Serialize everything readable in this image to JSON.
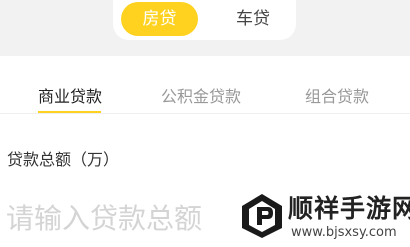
{
  "loan_type": {
    "options": [
      {
        "label": "房贷",
        "selected": true
      },
      {
        "label": "车贷",
        "selected": false
      }
    ]
  },
  "tabs": [
    {
      "label": "商业贷款",
      "active": true
    },
    {
      "label": "公积金贷款",
      "active": false
    },
    {
      "label": "组合贷款",
      "active": false
    }
  ],
  "form": {
    "amount_label": "贷款总额（万）",
    "amount_value": "",
    "amount_placeholder": "请输入贷款总额"
  },
  "watermark": {
    "title": "顺祥手游网",
    "url": "www.bjsxsy.com"
  },
  "colors": {
    "accent": "#ffd21f",
    "top_bar_bg": "#f2f2f2",
    "active_text": "#222222",
    "inactive_text": "#999999"
  }
}
